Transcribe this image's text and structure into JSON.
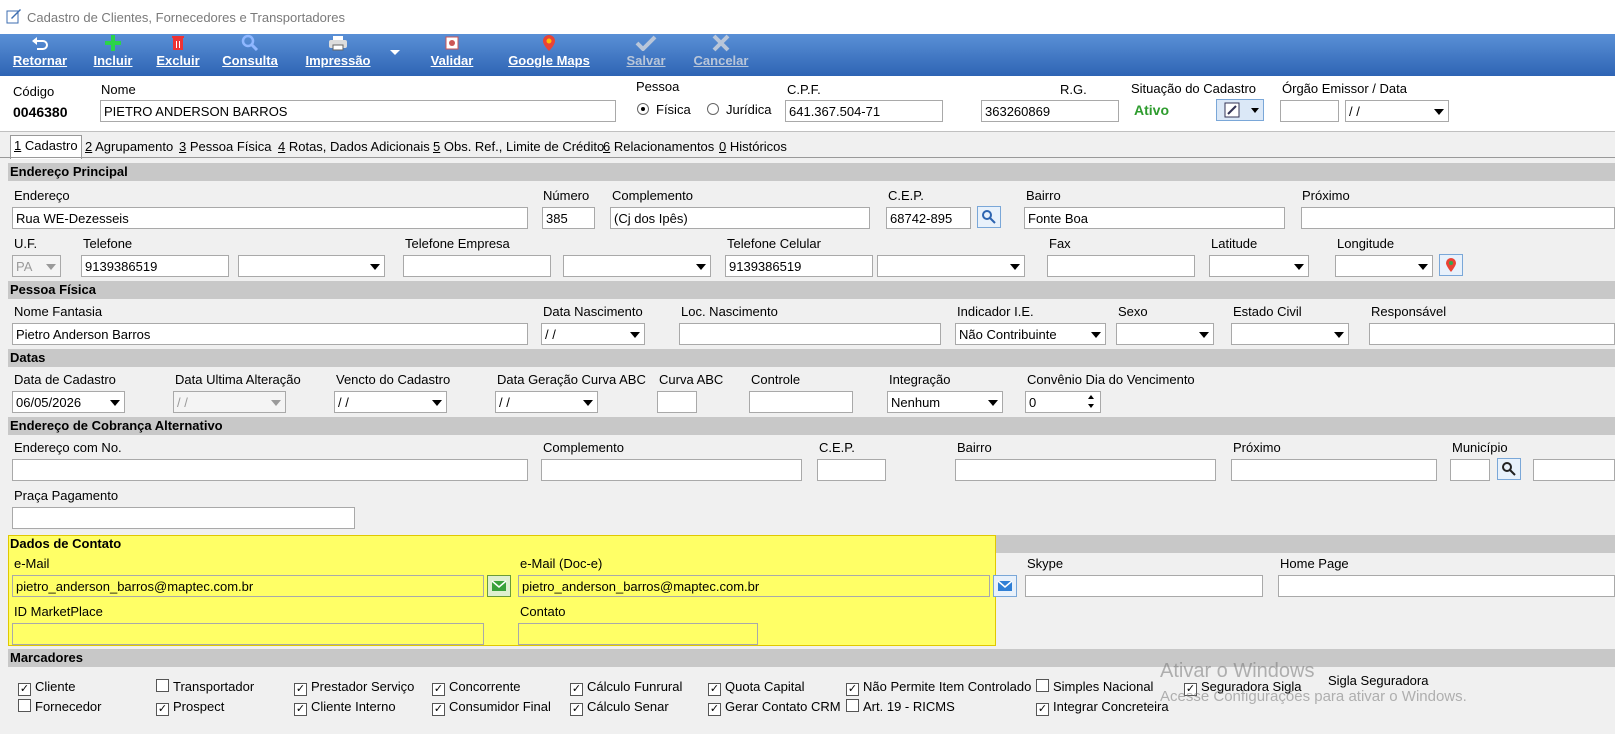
{
  "window": {
    "title": "Cadastro de Clientes, Fornecedores e Transportadores"
  },
  "toolbar": {
    "retornar": "Retornar",
    "incluir": "Incluir",
    "excluir": "Excluir",
    "consulta": "Consulta",
    "impressao": "Impressão",
    "validar": "Validar",
    "google_maps": "Google Maps",
    "salvar": "Salvar",
    "cancelar": "Cancelar"
  },
  "header": {
    "codigo_label": "Código",
    "codigo_value": "0046380",
    "nome_label": "Nome",
    "nome_value": "PIETRO ANDERSON BARROS",
    "pessoa_label": "Pessoa",
    "fisica_label": "Física",
    "juridica_label": "Jurídica",
    "cpf_label": "C.P.F.",
    "cpf_value": "641.367.504-71",
    "rg_label": "R.G.",
    "rg_value": "363260869",
    "situacao_label": "Situação do Cadastro",
    "situacao_value": "Ativo",
    "orgao_label": "Órgão Emissor  / Data",
    "orgao_value": "",
    "orgao_data": " / /"
  },
  "tabs": [
    {
      "num": "1",
      "label": " Cadastro"
    },
    {
      "num": "2",
      "label": " Agrupamento"
    },
    {
      "num": "3",
      "label": " Pessoa Física"
    },
    {
      "num": "4",
      "label": " Rotas, Dados Adicionais"
    },
    {
      "num": "5",
      "label": " Obs. Ref., Limite de Crédito"
    },
    {
      "num": "6",
      "label": " Relacionamentos"
    },
    {
      "num": "0",
      "label": " Históricos"
    }
  ],
  "endereco": {
    "section": "Endereço Principal",
    "endereco_label": "Endereço",
    "endereco_value": "Rua WE-Dezesseis",
    "numero_label": "Número",
    "numero_value": "385",
    "complemento_label": "Complemento",
    "complemento_value": "(Cj dos Ipês)",
    "cep_label": "C.E.P.",
    "cep_value": "68742-895",
    "bairro_label": "Bairro",
    "bairro_value": "Fonte Boa",
    "proximo_label": "Próximo",
    "proximo_value": "",
    "uf_label": "U.F.",
    "uf_value": "PA",
    "telefone_label": "Telefone",
    "telefone_value": "9139386519",
    "tel_empresa_label": "Telefone Empresa",
    "tel_celular_label": "Telefone Celular",
    "tel_celular_value": "9139386519",
    "fax_label": "Fax",
    "latitude_label": "Latitude",
    "longitude_label": "Longitude"
  },
  "pessoa_fisica": {
    "section": "Pessoa Física",
    "fantasia_label": "Nome Fantasia",
    "fantasia_value": "Pietro Anderson Barros",
    "nasc_label": "Data Nascimento",
    "nasc_value": " / /",
    "loc_label": "Loc. Nascimento",
    "ie_label": "Indicador I.E.",
    "ie_value": "Não Contribuinte",
    "sexo_label": "Sexo",
    "civil_label": "Estado Civil",
    "resp_label": "Responsável"
  },
  "datas": {
    "section": "Datas",
    "cadastro_label": "Data de Cadastro",
    "cadastro_value": "06/05/2026",
    "alteracao_label": "Data Ultima Alteração",
    "alteracao_value": " / /",
    "vencto_label": "Vencto do Cadastro",
    "vencto_value": " / /",
    "curva_data_label": "Data Geração Curva ABC",
    "curva_data_value": " / /",
    "curva_label": "Curva ABC",
    "controle_label": "Controle",
    "integracao_label": "Integração",
    "integracao_value": "Nenhum",
    "convenio_label": "Convênio Dia do Vencimento",
    "convenio_value": "0"
  },
  "cobranca": {
    "section": "Endereço de Cobrança Alternativo",
    "endereco_label": "Endereço com No.",
    "complemento_label": "Complemento",
    "cep_label": "C.E.P.",
    "bairro_label": "Bairro",
    "proximo_label": "Próximo",
    "municipio_label": "Município",
    "praca_label": "Praça Pagamento"
  },
  "contato": {
    "section": "Dados de Contato",
    "email_label": "e-Mail",
    "email_value": "pietro_anderson_barros@maptec.com.br",
    "email_doc_label": "e-Mail (Doc-e)",
    "email_doc_value": "pietro_anderson_barros@maptec.com.br",
    "skype_label": "Skype",
    "home_label": "Home Page",
    "market_label": "ID MarketPlace",
    "contato_label": "Contato"
  },
  "marcadores": {
    "section": "Marcadores",
    "items": [
      {
        "label": "Cliente",
        "checked": true
      },
      {
        "label": "Transportador",
        "checked": false
      },
      {
        "label": "Prestador Serviço",
        "checked": true
      },
      {
        "label": "Concorrente",
        "checked": true
      },
      {
        "label": "Cálculo Funrural",
        "checked": true
      },
      {
        "label": "Quota Capital",
        "checked": true
      },
      {
        "label": "Não Permite Item Controlado",
        "checked": true
      },
      {
        "label": "Simples Nacional",
        "checked": false
      },
      {
        "label": "Seguradora Sigla",
        "checked": true
      },
      {
        "label": "Fornecedor",
        "checked": false
      },
      {
        "label": "Prospect",
        "checked": true
      },
      {
        "label": "Cliente Interno",
        "checked": true
      },
      {
        "label": "Consumidor Final",
        "checked": true
      },
      {
        "label": "Cálculo Senar",
        "checked": true
      },
      {
        "label": "Gerar Contato CRM",
        "checked": true
      },
      {
        "label": "Art. 19 - RICMS",
        "checked": false
      },
      {
        "label": "Integrar Concreteira",
        "checked": true
      }
    ],
    "sigla_label": "Sigla Seguradora"
  },
  "watermark": {
    "line1": "Ativar o Windows",
    "line2": "Acesse Configurações para ativar o Windows."
  },
  "colors": {
    "titlebar": "#ffffff",
    "toolbar": "#3f79c6",
    "highlight": "#ffff66",
    "ativo": "#2e9c2e"
  }
}
